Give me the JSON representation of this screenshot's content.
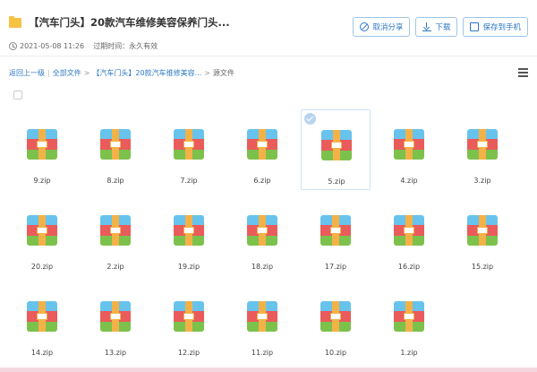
{
  "header": {
    "title": "【汽车门头】20款汽车维修美容保养门头...",
    "date": "2021-05-08 11:26",
    "expiry": "过期时间：永久有效"
  },
  "actions": {
    "cancel_share": "取消分享",
    "download": "下载",
    "save_to_phone": "保存到手机"
  },
  "breadcrumb": {
    "back": "返回上一级",
    "all_files": "全部文件",
    "folder": "【汽车门头】20款汽车维修美容...",
    "current": "源文件"
  },
  "icons": {
    "folder": "folder-icon",
    "clock": "clock-icon",
    "menu": "menu-icon",
    "zip": "zip-archive-icon"
  },
  "colors": {
    "accent": "#2d78c4",
    "folder": "#f6c244",
    "zip_blue": "#67c3ec",
    "zip_red": "#ea5b5b",
    "zip_green": "#7cc14c",
    "zip_strap": "#f3b247"
  },
  "files": [
    {
      "name": "9.zip",
      "selected": false
    },
    {
      "name": "8.zip",
      "selected": false
    },
    {
      "name": "7.zip",
      "selected": false
    },
    {
      "name": "6.zip",
      "selected": false
    },
    {
      "name": "5.zip",
      "selected": true
    },
    {
      "name": "4.zip",
      "selected": false
    },
    {
      "name": "3.zip",
      "selected": false
    },
    {
      "name": "20.zip",
      "selected": false
    },
    {
      "name": "2.zip",
      "selected": false
    },
    {
      "name": "19.zip",
      "selected": false
    },
    {
      "name": "18.zip",
      "selected": false
    },
    {
      "name": "17.zip",
      "selected": false
    },
    {
      "name": "16.zip",
      "selected": false
    },
    {
      "name": "15.zip",
      "selected": false
    },
    {
      "name": "14.zip",
      "selected": false
    },
    {
      "name": "13.zip",
      "selected": false
    },
    {
      "name": "12.zip",
      "selected": false
    },
    {
      "name": "11.zip",
      "selected": false
    },
    {
      "name": "10.zip",
      "selected": false
    },
    {
      "name": "1.zip",
      "selected": false
    }
  ]
}
